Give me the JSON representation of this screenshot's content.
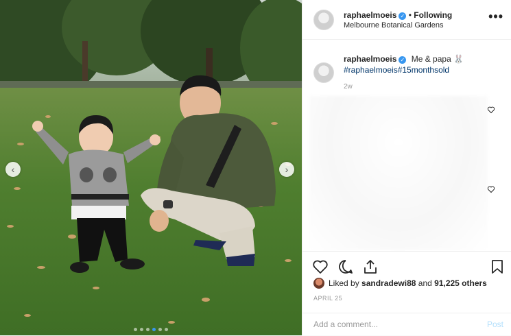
{
  "post": {
    "media": {
      "image_alt": "Toddler in a grey Mickey sweater and a man in an olive jacket crouching on a grassy lawn",
      "prev_icon": "chevron-left-icon",
      "next_icon": "chevron-right-icon",
      "carousel_dot_count": 6,
      "carousel_active_index": 3
    },
    "header": {
      "username": "raphaelmoeis",
      "verified_icon": "verified-badge-icon",
      "separator": "•",
      "follow_label": "Following",
      "location": "Melbourne Botanical Gardens",
      "more_icon": "more-options-icon",
      "more_label": "•••"
    },
    "caption": {
      "username": "raphaelmoeis",
      "text": "Me & papa 🐰",
      "hashtags": "#raphaelmoeis#15monthsold",
      "time": "2w"
    },
    "comments_icons": [
      "heart-outline-icon",
      "heart-outline-icon"
    ],
    "actions": {
      "like_icon": "heart-outline-icon",
      "comment_icon": "comment-icon",
      "share_icon": "share-icon",
      "save_icon": "bookmark-icon"
    },
    "likes": {
      "prefix": "Liked by",
      "user": "sandradewi88",
      "middle": "and",
      "count_text": "91,225 others"
    },
    "date": "APRIL 25",
    "comment_box": {
      "placeholder": "Add a comment...",
      "post_label": "Post"
    },
    "colors": {
      "link_blue": "#003569",
      "verified_blue": "#3897f0",
      "post_disabled": "#b2dffc",
      "grass": "#4a7a30"
    }
  }
}
